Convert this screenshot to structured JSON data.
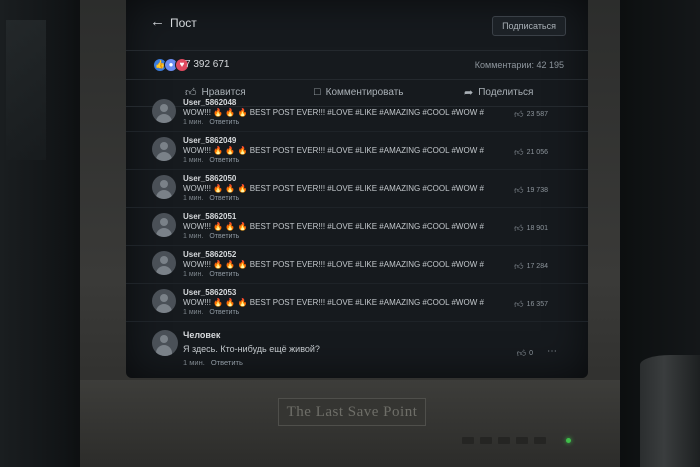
{
  "header": {
    "back_icon": "arrow-left-icon",
    "title": "Пост",
    "subscribe_label": "Подписаться"
  },
  "stats": {
    "reactions": [
      "like-icon",
      "wow-icon",
      "heart-icon"
    ],
    "likes_count": "7 392 671",
    "comments_label": "Комментарии: 42 195"
  },
  "actions": {
    "like_label": "Нравится",
    "comment_label": "Комментировать",
    "share_label": "Поделиться"
  },
  "comments": [
    {
      "author": "User_5862048",
      "text": "WOW!!! 🔥 🔥 🔥 BEST POST EVER!!! #LOVE #LIKE #AMAZING #COOL #WOW #",
      "time": "1 мин.",
      "reply": "Ответить",
      "likes": "23 587"
    },
    {
      "author": "User_5862049",
      "text": "WOW!!! 🔥 🔥 🔥 BEST POST EVER!!! #LOVE #LIKE #AMAZING #COOL #WOW #",
      "time": "1 мин.",
      "reply": "Ответить",
      "likes": "21 056"
    },
    {
      "author": "User_5862050",
      "text": "WOW!!! 🔥 🔥 🔥 BEST POST EVER!!! #LOVE #LIKE #AMAZING #COOL #WOW #",
      "time": "1 мин.",
      "reply": "Ответить",
      "likes": "19 738"
    },
    {
      "author": "User_5862051",
      "text": "WOW!!! 🔥 🔥 🔥 BEST POST EVER!!! #LOVE #LIKE #AMAZING #COOL #WOW #",
      "time": "1 мин.",
      "reply": "Ответить",
      "likes": "18 901"
    },
    {
      "author": "User_5862052",
      "text": "WOW!!! 🔥 🔥 🔥 BEST POST EVER!!! #LOVE #LIKE #AMAZING #COOL #WOW #",
      "time": "1 мин.",
      "reply": "Ответить",
      "likes": "17 284"
    },
    {
      "author": "User_5862053",
      "text": "WOW!!! 🔥 🔥 🔥 BEST POST EVER!!! #LOVE #LIKE #AMAZING #COOL #WOW #",
      "time": "1 мин.",
      "reply": "Ответить",
      "likes": "16 357"
    }
  ],
  "last_comment": {
    "author": "Человек",
    "text": "Я здесь. Кто-нибудь ещё живой?",
    "time": "1 мин.",
    "reply": "Ответить",
    "likes": "0",
    "more_icon": "more-dots-icon"
  },
  "monitor": {
    "brand": "The Last Save Point"
  },
  "colors": {
    "screen_bg": "#161a1e",
    "text": "#d6d9dc",
    "muted": "#8d959c",
    "like_blue": "#3b7ddd",
    "love_red": "#e04a5f",
    "power_led": "#3fbf4a"
  }
}
